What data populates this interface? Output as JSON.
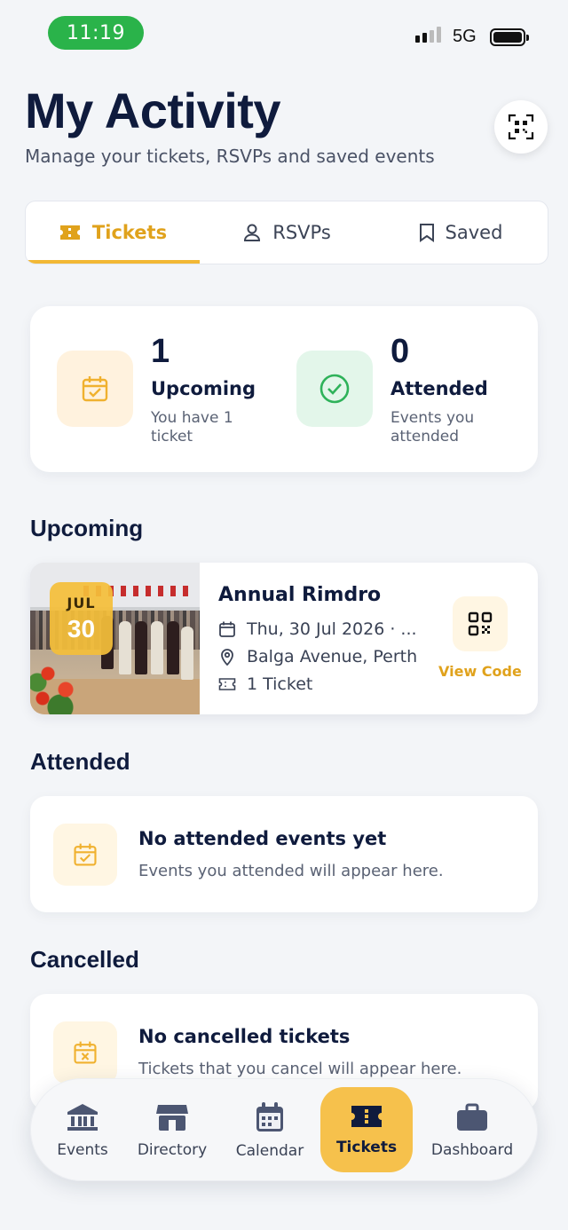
{
  "status_bar": {
    "time": "11:19",
    "network": "5G"
  },
  "header": {
    "title": "My Activity",
    "subtitle": "Manage your tickets, RSVPs and saved events"
  },
  "tabs": [
    {
      "label": "Tickets",
      "icon": "ticket-icon",
      "active": true
    },
    {
      "label": "RSVPs",
      "icon": "person-icon",
      "active": false
    },
    {
      "label": "Saved",
      "icon": "bookmark-icon",
      "active": false
    }
  ],
  "stats": {
    "upcoming": {
      "count": "1",
      "label": "Upcoming",
      "desc": "You have 1 ticket",
      "icon": "calendar-check-icon"
    },
    "attended": {
      "count": "0",
      "label": "Attended",
      "desc": "Events you attended",
      "icon": "check-circle-icon"
    }
  },
  "sections": {
    "upcoming": "Upcoming",
    "attended": "Attended",
    "cancelled": "Cancelled"
  },
  "upcoming_event": {
    "month": "JUL",
    "day": "30",
    "title": "Annual Rimdro",
    "date": "Thu, 30 Jul 2026 · ...",
    "location": "Balga Avenue, Perth",
    "tickets": "1 Ticket",
    "view_code": "View Code"
  },
  "attended_empty": {
    "title": "No attended events yet",
    "desc": "Events you attended will appear here."
  },
  "cancelled_empty": {
    "title": "No cancelled tickets",
    "desc": "Tickets that you cancel will appear here."
  },
  "bottom_nav": [
    {
      "label": "Events",
      "icon": "bank-icon",
      "active": false
    },
    {
      "label": "Directory",
      "icon": "store-icon",
      "active": false
    },
    {
      "label": "Calendar",
      "icon": "calendar-icon",
      "active": false
    },
    {
      "label": "Tickets",
      "icon": "ticket-icon",
      "active": true
    },
    {
      "label": "Dashboard",
      "icon": "briefcase-icon",
      "active": false
    }
  ],
  "colors": {
    "accent": "#f2b835",
    "accent_text": "#e0a21c",
    "navy": "#0f1b3d",
    "success": "#2fb25a",
    "background": "#f3f5f8"
  }
}
